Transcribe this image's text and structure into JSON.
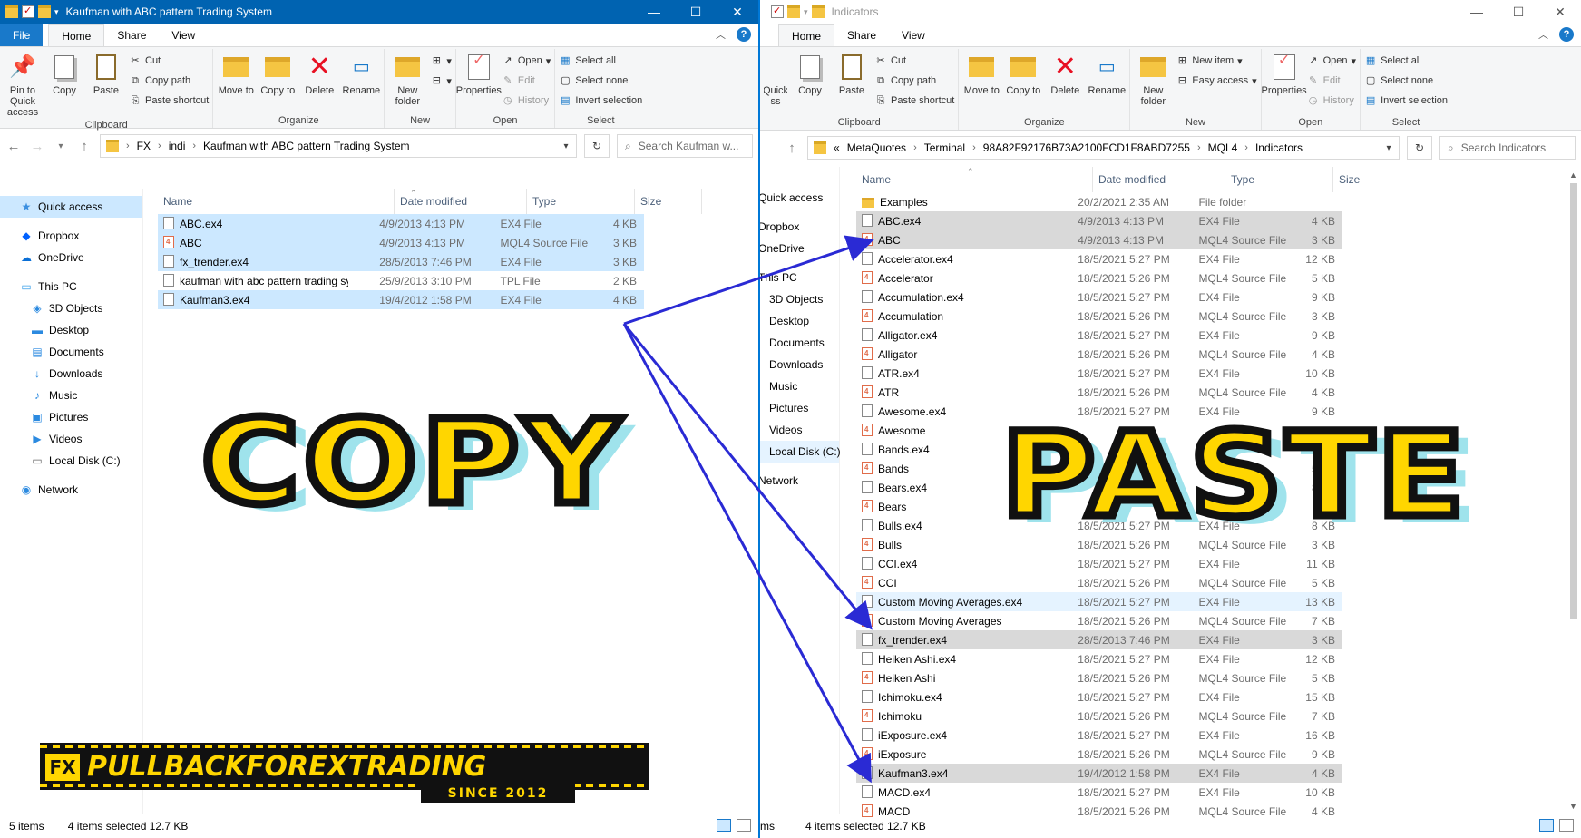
{
  "left": {
    "title": "Kaufman with ABC pattern Trading System",
    "tabs": [
      "File",
      "Home",
      "Share",
      "View"
    ],
    "ribbon": {
      "clipboard": {
        "pin": "Pin to Quick access",
        "copy": "Copy",
        "paste": "Paste",
        "cut": "Cut",
        "copy_path": "Copy path",
        "paste_shortcut": "Paste shortcut",
        "label": "Clipboard"
      },
      "organize": {
        "move": "Move to",
        "copy": "Copy to",
        "delete": "Delete",
        "rename": "Rename",
        "label": "Organize"
      },
      "new": {
        "new_folder": "New folder",
        "label": "New"
      },
      "open": {
        "properties": "Properties",
        "open": "Open",
        "edit": "Edit",
        "history": "History",
        "label": "Open"
      },
      "select": {
        "select_all": "Select all",
        "select_none": "Select none",
        "invert": "Invert selection",
        "label": "Select"
      }
    },
    "address": [
      "FX",
      "indi",
      "Kaufman with ABC pattern Trading System"
    ],
    "search_placeholder": "Search Kaufman w...",
    "nav": [
      {
        "label": "Quick access",
        "icon": "star-icon",
        "level": 0,
        "state": "sel"
      },
      {
        "label": "Dropbox",
        "icon": "dropbox-icon",
        "level": 0,
        "state": ""
      },
      {
        "label": "OneDrive",
        "icon": "cloud-icon",
        "level": 0,
        "state": ""
      },
      {
        "label": "This PC",
        "icon": "pc-icon",
        "level": 0,
        "state": ""
      },
      {
        "label": "3D Objects",
        "icon": "cube-icon",
        "level": 1,
        "state": ""
      },
      {
        "label": "Desktop",
        "icon": "desktop-icon",
        "level": 1,
        "state": ""
      },
      {
        "label": "Documents",
        "icon": "documents-icon",
        "level": 1,
        "state": ""
      },
      {
        "label": "Downloads",
        "icon": "download-icon",
        "level": 1,
        "state": ""
      },
      {
        "label": "Music",
        "icon": "music-icon",
        "level": 1,
        "state": ""
      },
      {
        "label": "Pictures",
        "icon": "pictures-icon",
        "level": 1,
        "state": ""
      },
      {
        "label": "Videos",
        "icon": "videos-icon",
        "level": 1,
        "state": ""
      },
      {
        "label": "Local Disk (C:)",
        "icon": "disk-icon",
        "level": 1,
        "state": ""
      },
      {
        "label": "Network",
        "icon": "network-icon",
        "level": 0,
        "state": ""
      }
    ],
    "columns": [
      "Name",
      "Date modified",
      "Type",
      "Size"
    ],
    "files": [
      {
        "name": "ABC.ex4",
        "date": "4/9/2013 4:13 PM",
        "type": "EX4 File",
        "size": "4 KB",
        "kind": "file",
        "sel": "selblue"
      },
      {
        "name": "ABC",
        "date": "4/9/2013 4:13 PM",
        "type": "MQL4 Source File",
        "size": "3 KB",
        "kind": "src",
        "sel": "selblue"
      },
      {
        "name": "fx_trender.ex4",
        "date": "28/5/2013 7:46 PM",
        "type": "EX4 File",
        "size": "3 KB",
        "kind": "file",
        "sel": "selblue"
      },
      {
        "name": "kaufman with abc pattern trading system...",
        "date": "25/9/2013 3:10 PM",
        "type": "TPL File",
        "size": "2 KB",
        "kind": "file",
        "sel": ""
      },
      {
        "name": "Kaufman3.ex4",
        "date": "19/4/2012 1:58 PM",
        "type": "EX4 File",
        "size": "4 KB",
        "kind": "file",
        "sel": "selblue"
      }
    ],
    "status": {
      "items": "5 items",
      "selected": "4 items selected  12.7 KB"
    }
  },
  "right": {
    "title": "Indicators",
    "tabs": [
      "Home",
      "Share",
      "View"
    ],
    "ribbon": {
      "clipboard": {
        "pin": "Quick ss",
        "copy": "Copy",
        "paste": "Paste",
        "cut": "Cut",
        "copy_path": "Copy path",
        "paste_shortcut": "Paste shortcut",
        "label": "Clipboard"
      },
      "organize": {
        "move": "Move to",
        "copy": "Copy to",
        "delete": "Delete",
        "rename": "Rename",
        "label": "Organize"
      },
      "new": {
        "new_folder": "New folder",
        "new_item": "New item",
        "easy_access": "Easy access",
        "label": "New"
      },
      "open": {
        "properties": "Properties",
        "open": "Open",
        "edit": "Edit",
        "history": "History",
        "label": "Open"
      },
      "select": {
        "select_all": "Select all",
        "select_none": "Select none",
        "invert": "Invert selection",
        "label": "Select"
      }
    },
    "address_prefix": "«",
    "address": [
      "MetaQuotes",
      "Terminal",
      "98A82F92176B73A2100FCD1F8ABD7255",
      "MQL4",
      "Indicators"
    ],
    "search_placeholder": "Search Indicators",
    "nav": [
      {
        "label": "Quick access",
        "level": 0,
        "state": ""
      },
      {
        "label": "Dropbox",
        "level": 0,
        "state": ""
      },
      {
        "label": "OneDrive",
        "level": 0,
        "state": ""
      },
      {
        "label": "This PC",
        "level": 0,
        "state": ""
      },
      {
        "label": "3D Objects",
        "level": 1,
        "state": ""
      },
      {
        "label": "Desktop",
        "level": 1,
        "state": ""
      },
      {
        "label": "Documents",
        "level": 1,
        "state": ""
      },
      {
        "label": "Downloads",
        "level": 1,
        "state": ""
      },
      {
        "label": "Music",
        "level": 1,
        "state": ""
      },
      {
        "label": "Pictures",
        "level": 1,
        "state": ""
      },
      {
        "label": "Videos",
        "level": 1,
        "state": ""
      },
      {
        "label": "Local Disk (C:)",
        "level": 1,
        "state": "hover"
      },
      {
        "label": "Network",
        "level": 0,
        "state": ""
      }
    ],
    "columns": [
      "Name",
      "Date modified",
      "Type",
      "Size"
    ],
    "files": [
      {
        "name": "Examples",
        "date": "20/2/2021 2:35 AM",
        "type": "File folder",
        "size": "",
        "kind": "fld",
        "sel": ""
      },
      {
        "name": "ABC.ex4",
        "date": "4/9/2013 4:13 PM",
        "type": "EX4 File",
        "size": "4 KB",
        "kind": "file",
        "sel": "selgray"
      },
      {
        "name": "ABC",
        "date": "4/9/2013 4:13 PM",
        "type": "MQL4 Source File",
        "size": "3 KB",
        "kind": "src",
        "sel": "selgray"
      },
      {
        "name": "Accelerator.ex4",
        "date": "18/5/2021 5:27 PM",
        "type": "EX4 File",
        "size": "12 KB",
        "kind": "file",
        "sel": ""
      },
      {
        "name": "Accelerator",
        "date": "18/5/2021 5:26 PM",
        "type": "MQL4 Source File",
        "size": "5 KB",
        "kind": "src",
        "sel": ""
      },
      {
        "name": "Accumulation.ex4",
        "date": "18/5/2021 5:27 PM",
        "type": "EX4 File",
        "size": "9 KB",
        "kind": "file",
        "sel": ""
      },
      {
        "name": "Accumulation",
        "date": "18/5/2021 5:26 PM",
        "type": "MQL4 Source File",
        "size": "3 KB",
        "kind": "src",
        "sel": ""
      },
      {
        "name": "Alligator.ex4",
        "date": "18/5/2021 5:27 PM",
        "type": "EX4 File",
        "size": "9 KB",
        "kind": "file",
        "sel": ""
      },
      {
        "name": "Alligator",
        "date": "18/5/2021 5:26 PM",
        "type": "MQL4 Source File",
        "size": "4 KB",
        "kind": "src",
        "sel": ""
      },
      {
        "name": "ATR.ex4",
        "date": "18/5/2021 5:27 PM",
        "type": "EX4 File",
        "size": "10 KB",
        "kind": "file",
        "sel": ""
      },
      {
        "name": "ATR",
        "date": "18/5/2021 5:26 PM",
        "type": "MQL4 Source File",
        "size": "4 KB",
        "kind": "src",
        "sel": ""
      },
      {
        "name": "Awesome.ex4",
        "date": "18/5/2021 5:27 PM",
        "type": "EX4 File",
        "size": "9 KB",
        "kind": "file",
        "sel": ""
      },
      {
        "name": "Awesome",
        "date": "",
        "type": "",
        "size": "",
        "kind": "src",
        "sel": ""
      },
      {
        "name": "Bands.ex4",
        "date": "",
        "type": "",
        "size": "",
        "kind": "file",
        "sel": ""
      },
      {
        "name": "Bands",
        "date": "",
        "type": "",
        "size": "5 KB",
        "kind": "src",
        "sel": ""
      },
      {
        "name": "Bears.ex4",
        "date": "",
        "type": "",
        "size": "8 KB",
        "kind": "file",
        "sel": ""
      },
      {
        "name": "Bears",
        "date": "",
        "type": "",
        "size": "",
        "kind": "src",
        "sel": ""
      },
      {
        "name": "Bulls.ex4",
        "date": "18/5/2021 5:27 PM",
        "type": "EX4 File",
        "size": "8 KB",
        "kind": "file",
        "sel": ""
      },
      {
        "name": "Bulls",
        "date": "18/5/2021 5:26 PM",
        "type": "MQL4 Source File",
        "size": "3 KB",
        "kind": "src",
        "sel": ""
      },
      {
        "name": "CCI.ex4",
        "date": "18/5/2021 5:27 PM",
        "type": "EX4 File",
        "size": "11 KB",
        "kind": "file",
        "sel": ""
      },
      {
        "name": "CCI",
        "date": "18/5/2021 5:26 PM",
        "type": "MQL4 Source File",
        "size": "5 KB",
        "kind": "src",
        "sel": ""
      },
      {
        "name": "Custom Moving Averages.ex4",
        "date": "18/5/2021 5:27 PM",
        "type": "EX4 File",
        "size": "13 KB",
        "kind": "file",
        "sel": "hov"
      },
      {
        "name": "Custom Moving Averages",
        "date": "18/5/2021 5:26 PM",
        "type": "MQL4 Source File",
        "size": "7 KB",
        "kind": "src",
        "sel": ""
      },
      {
        "name": "fx_trender.ex4",
        "date": "28/5/2013 7:46 PM",
        "type": "EX4 File",
        "size": "3 KB",
        "kind": "file",
        "sel": "selgray"
      },
      {
        "name": "Heiken Ashi.ex4",
        "date": "18/5/2021 5:27 PM",
        "type": "EX4 File",
        "size": "12 KB",
        "kind": "file",
        "sel": ""
      },
      {
        "name": "Heiken Ashi",
        "date": "18/5/2021 5:26 PM",
        "type": "MQL4 Source File",
        "size": "5 KB",
        "kind": "src",
        "sel": ""
      },
      {
        "name": "Ichimoku.ex4",
        "date": "18/5/2021 5:27 PM",
        "type": "EX4 File",
        "size": "15 KB",
        "kind": "file",
        "sel": ""
      },
      {
        "name": "Ichimoku",
        "date": "18/5/2021 5:26 PM",
        "type": "MQL4 Source File",
        "size": "7 KB",
        "kind": "src",
        "sel": ""
      },
      {
        "name": "iExposure.ex4",
        "date": "18/5/2021 5:27 PM",
        "type": "EX4 File",
        "size": "16 KB",
        "kind": "file",
        "sel": ""
      },
      {
        "name": "iExposure",
        "date": "18/5/2021 5:26 PM",
        "type": "MQL4 Source File",
        "size": "9 KB",
        "kind": "src",
        "sel": ""
      },
      {
        "name": "Kaufman3.ex4",
        "date": "19/4/2012 1:58 PM",
        "type": "EX4 File",
        "size": "4 KB",
        "kind": "file",
        "sel": "selgray"
      },
      {
        "name": "MACD.ex4",
        "date": "18/5/2021 5:27 PM",
        "type": "EX4 File",
        "size": "10 KB",
        "kind": "file",
        "sel": ""
      },
      {
        "name": "MACD",
        "date": "18/5/2021 5:26 PM",
        "type": "MQL4 Source File",
        "size": "4 KB",
        "kind": "src",
        "sel": ""
      }
    ],
    "status": {
      "items": "ms",
      "selected": "4 items selected  12.7 KB"
    }
  },
  "overlay": {
    "copy_word": "COPY",
    "paste_word": "PASTE",
    "arrow_color": "#2a2ad4",
    "logo_fx": "FX",
    "logo_main": "PULLBACKFOREXTRADING",
    "logo_since": "SINCE 2012"
  }
}
